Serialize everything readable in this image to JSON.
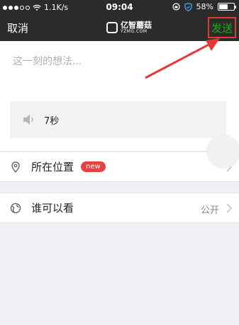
{
  "status_bar": {
    "carrier_speed": "1.1K/s",
    "time": "09:04",
    "battery": "58%",
    "battery_level": 0.58
  },
  "nav": {
    "cancel_label": "取消",
    "logo_cn": "亿智蘑菇",
    "logo_en": "YZMG.COM",
    "send_label": "发送",
    "highlight_color": "#e53935",
    "send_color": "#1aad19"
  },
  "compose": {
    "placeholder": "这一刻的想法...",
    "voice_duration": "7秒"
  },
  "location_row": {
    "label": "所在位置",
    "badge": "new"
  },
  "visibility_row": {
    "label": "谁可以看",
    "value": "公开"
  }
}
